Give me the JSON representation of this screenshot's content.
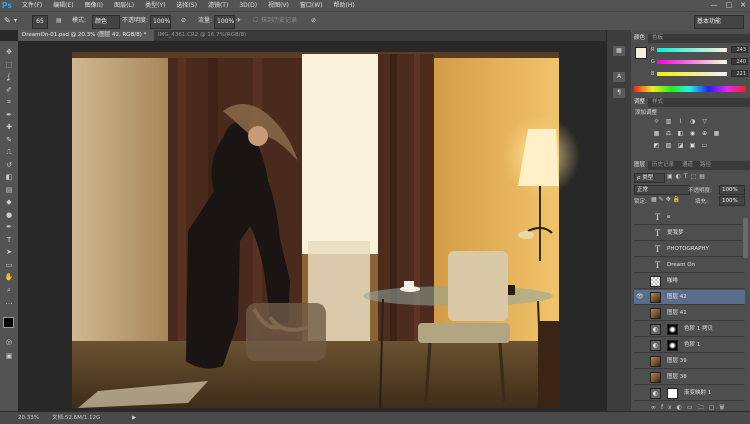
{
  "app": {
    "logo": "Ps"
  },
  "menubar": {
    "items": [
      "文件(F)",
      "编辑(E)",
      "图像(I)",
      "图层(L)",
      "类型(Y)",
      "选择(S)",
      "滤镜(T)",
      "3D(D)",
      "视图(V)",
      "窗口(W)",
      "帮助(H)"
    ],
    "window_buttons": [
      "—",
      "□",
      "✕"
    ]
  },
  "options": {
    "brush_size": "65",
    "mode_label": "模式:",
    "mode_value": "颜色",
    "opacity_label": "不透明度:",
    "opacity_value": "100%",
    "flow_label": "流量:",
    "flow_value": "100%",
    "history_label": "抹到历史记录",
    "workspace": "基本功能"
  },
  "tabs": [
    {
      "label": "DreamOn-01.psd @ 20.3% (图层 42, RGB/8) *",
      "active": true
    },
    {
      "label": "IMG_4361.CR2 @ 16.7%(RGB/8)",
      "active": false
    }
  ],
  "status": {
    "zoom": "20.33%",
    "doc": "文档:52.6M/1.12G"
  },
  "color_panel": {
    "tabs": [
      "颜色",
      "色板"
    ],
    "channels": [
      {
        "label": "R",
        "value": "243"
      },
      {
        "label": "G",
        "value": "240"
      },
      {
        "label": "B",
        "value": "221"
      }
    ]
  },
  "adjust_panel": {
    "tabs": [
      "调整",
      "样式"
    ],
    "title": "添加调整"
  },
  "layers_panel": {
    "tabs": [
      "图层",
      "历史记录",
      "通道",
      "路径"
    ],
    "filter_label": "ρ 类型",
    "blend_mode": "正常",
    "opacity_label": "不透明度:",
    "opacity_value": "100%",
    "lock_label": "锁定:",
    "fill_label": "填充:",
    "fill_value": "100%",
    "layers": [
      {
        "name": "e",
        "type": "text",
        "visible": false,
        "selected": false
      },
      {
        "name": "爱我梦",
        "type": "text",
        "visible": false,
        "selected": false
      },
      {
        "name": "PHOTOGRAPHY",
        "type": "text",
        "visible": false,
        "selected": false
      },
      {
        "name": "Dream On",
        "type": "text",
        "visible": false,
        "selected": false
      },
      {
        "name": "咖啡",
        "type": "pixel",
        "visible": false,
        "selected": false
      },
      {
        "name": "图层 42",
        "type": "pixel",
        "visible": true,
        "selected": true
      },
      {
        "name": "图层 41",
        "type": "pixel",
        "visible": false,
        "selected": false
      },
      {
        "name": "色阶 1 拷贝",
        "type": "adjust",
        "visible": false,
        "selected": false
      },
      {
        "name": "色阶 1",
        "type": "adjust",
        "visible": false,
        "selected": false
      },
      {
        "name": "图层 39",
        "type": "pixel",
        "visible": false,
        "selected": false
      },
      {
        "name": "图层 38",
        "type": "pixel",
        "visible": false,
        "selected": false
      },
      {
        "name": "渐变映射 1",
        "type": "adjust",
        "visible": false,
        "selected": false
      }
    ]
  },
  "colors": {
    "accent": "#31a8ff",
    "selected_layer": "#5a6d8a",
    "fg_swatch": "#f3f0dd",
    "bg_swatch": "#ffffff"
  }
}
